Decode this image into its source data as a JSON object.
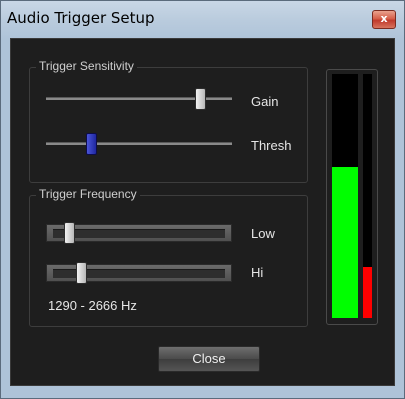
{
  "window": {
    "title": "Audio Trigger Setup",
    "close_glyph": "x"
  },
  "sensitivity": {
    "title": "Trigger Sensitivity",
    "gain": {
      "label": "Gain",
      "value": 0.85
    },
    "thresh": {
      "label": "Thresh",
      "value": 0.23
    }
  },
  "frequency": {
    "title": "Trigger Frequency",
    "low": {
      "label": "Low",
      "value": 0.1
    },
    "hi": {
      "label": "Hi",
      "value": 0.17
    },
    "range_text": "1290 - 2666 Hz"
  },
  "meters": {
    "left_level": 0.62,
    "right_level": 0.21,
    "left_color": "#00ff00",
    "right_color": "#ff0000"
  },
  "close_button": {
    "label": "Close"
  },
  "colors": {
    "background": "#1e1e1e",
    "text": "#e6e6e6",
    "thumb_active": "#2c35c4"
  }
}
